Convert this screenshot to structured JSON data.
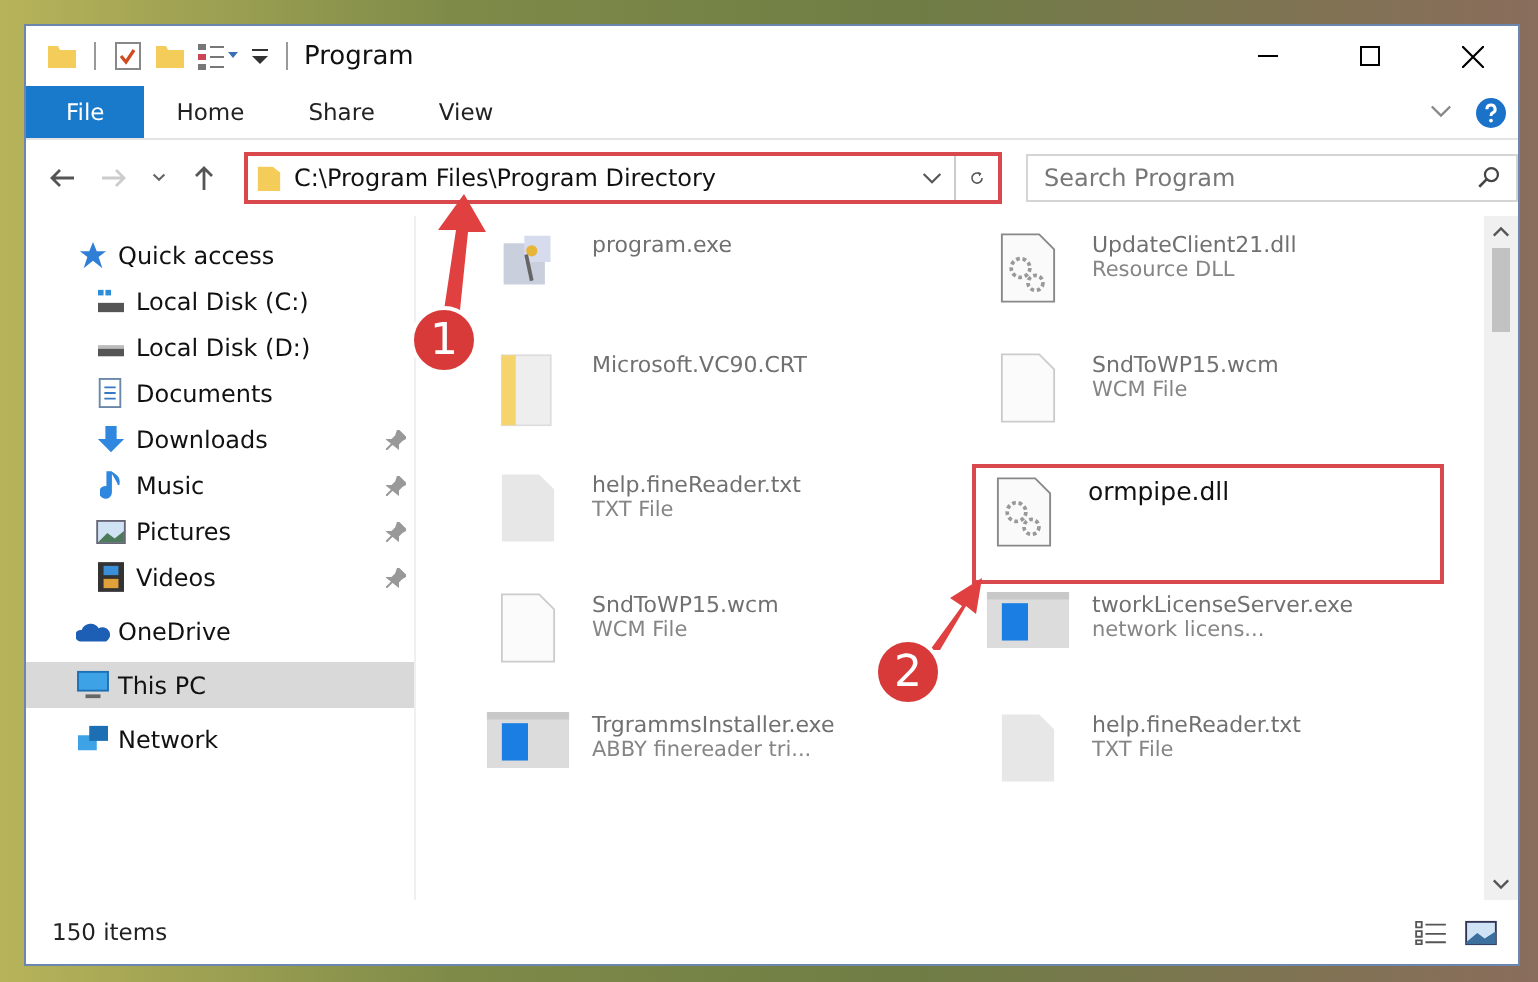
{
  "window": {
    "title": "Program"
  },
  "ribbon_tabs": [
    {
      "label": "File",
      "selected": true
    },
    {
      "label": "Home",
      "selected": false
    },
    {
      "label": "Share",
      "selected": false
    },
    {
      "label": "View",
      "selected": false
    }
  ],
  "address": {
    "path": "C:\\Program Files\\Program Directory"
  },
  "search": {
    "placeholder": "Search Program"
  },
  "sidebar": {
    "items": [
      {
        "label": "Quick access",
        "kind": "star",
        "pinned": false,
        "selected": false,
        "children": [
          {
            "label": "Local Disk (C:)",
            "kind": "diskc",
            "pinned": false,
            "selected": false
          },
          {
            "label": "Local Disk (D:)",
            "kind": "disk",
            "pinned": false,
            "selected": false
          },
          {
            "label": "Documents",
            "kind": "doc",
            "pinned": false,
            "selected": false
          },
          {
            "label": "Downloads",
            "kind": "download",
            "pinned": true,
            "selected": false
          },
          {
            "label": "Music",
            "kind": "music",
            "pinned": true,
            "selected": false
          },
          {
            "label": "Pictures",
            "kind": "pictures",
            "pinned": true,
            "selected": false
          },
          {
            "label": "Videos",
            "kind": "videos",
            "pinned": true,
            "selected": false
          }
        ]
      },
      {
        "label": "OneDrive",
        "kind": "cloud",
        "pinned": false,
        "selected": false
      },
      {
        "label": "This PC",
        "kind": "pc",
        "pinned": false,
        "selected": true
      },
      {
        "label": "Network",
        "kind": "network",
        "pinned": false,
        "selected": false
      }
    ]
  },
  "files": [
    {
      "name": "program.exe",
      "kind": "exe",
      "highlighted": false
    },
    {
      "name": "UpdateClient21.dll",
      "type": "Resource DLL",
      "kind": "dll",
      "highlighted": false
    },
    {
      "name": "Microsoft.VC90.CRT",
      "kind": "folder",
      "highlighted": false
    },
    {
      "name": "SndToWP15.wcm",
      "type": "WCM File",
      "kind": "file",
      "highlighted": false
    },
    {
      "name": "help.fineReader.txt",
      "type": "TXT File",
      "kind": "txt",
      "highlighted": false
    },
    {
      "name": "ormpipe.dll",
      "kind": "dll",
      "highlighted": true
    },
    {
      "name": "SndToWP15.wcm",
      "type": "WCM File",
      "kind": "file",
      "highlighted": false
    },
    {
      "name": "tworkLicenseServer.exe",
      "type": "network licens...",
      "kind": "installer",
      "highlighted": false
    },
    {
      "name": "TrgrammsInstaller.exe",
      "type": "ABBY finereader tri...",
      "kind": "installer",
      "highlighted": false
    },
    {
      "name": "help.fineReader.txt",
      "type": "TXT File",
      "kind": "txt",
      "highlighted": false
    }
  ],
  "status_bar": {
    "count": "150 items"
  },
  "annotations": [
    {
      "label": "1"
    },
    {
      "label": "2"
    }
  ]
}
